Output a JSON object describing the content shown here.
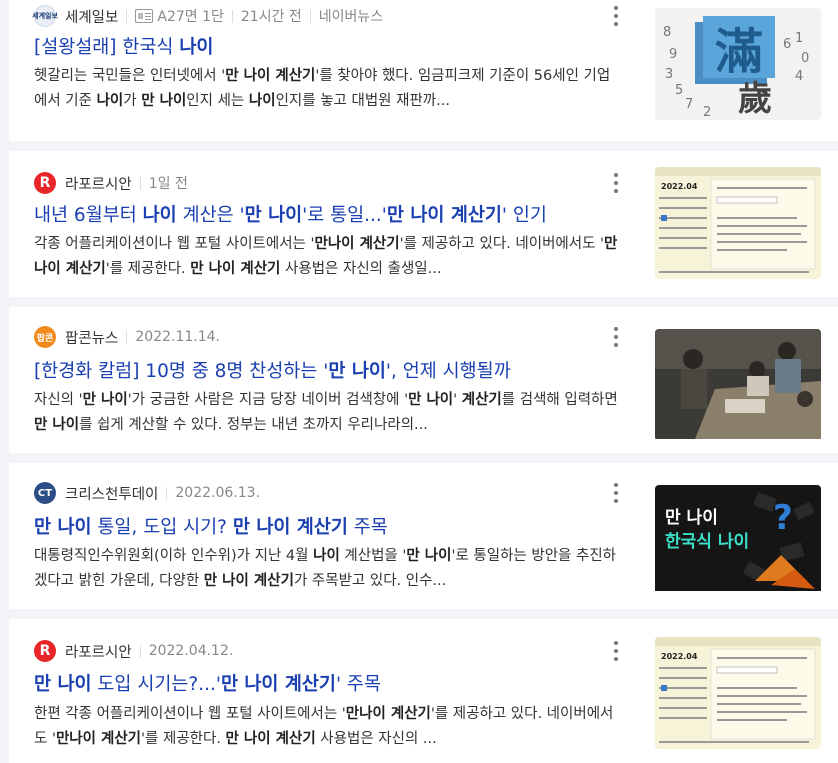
{
  "results": [
    {
      "source": "세계일보",
      "logo_text": "세계일보",
      "paper_label": "A27면 1단",
      "time": "21시간 전",
      "extra": "네이버뉴스",
      "title_parts": [
        "[설왕설래] 한국식 ",
        "나이"
      ],
      "desc_parts": [
        "헷갈리는 국민들은 인터넷에서 '",
        "만 나이 계산기",
        "'를 찾아야 했다. 임금피크제 기준이 56세인 기업에서 기준 ",
        "나이",
        "가 ",
        "만 나이",
        "인지 세는 ",
        "나이",
        "인지를 놓고 대법원 재판까..."
      ],
      "thumb_text": "滿 歲"
    },
    {
      "source": "라포르시안",
      "logo_text": "R",
      "time": "1일 전",
      "title_parts": [
        "내년 6월부터 ",
        "나이",
        " 계산은 '",
        "만 나이",
        "'로 통일...'",
        "만 나이 계산기",
        "' 인기"
      ],
      "desc_parts": [
        "각종 어플리케이션이나 웹 포털 사이트에서는 '",
        "만나이 계산기",
        "'를 제공하고 있다. 네이버에서도 '",
        "만나이 계산기",
        "'를 제공한다. ",
        "만 나이 계산기",
        " 사용법은 자신의 출생일..."
      ],
      "thumb_year": "2022.04"
    },
    {
      "source": "팝콘뉴스",
      "logo_text": "팝콘",
      "time": "2022.11.14.",
      "title_parts": [
        "[한경화 칼럼] 10명 중 8명 찬성하는 '",
        "만 나이",
        "', 언제 시행될까"
      ],
      "desc_parts": [
        "자신의 '",
        "만 나이",
        "'가 궁금한 사람은 지금 당장 네이버 검색창에 '",
        "만 나이",
        "' ",
        "계산기",
        "를 검색해 입력하면 ",
        "만 나이",
        "를 쉽게 계산할 수 있다. 정부는 내년 초까지 우리나라의..."
      ]
    },
    {
      "source": "크리스천투데이",
      "logo_text": "CT",
      "time": "2022.06.13.",
      "title_parts": [
        "",
        "만 나이",
        " 통일, 도입 시기? ",
        "만 나이 계산기",
        " 주목"
      ],
      "desc_parts": [
        "대통령직인수위원회(이하 인수위)가 지난 4월 ",
        "나이",
        " 계산법을 '",
        "만 나이",
        "'로 통일하는 방안을 추진하겠다고 밝힌 가운데, 다양한 ",
        "만 나이 계산기",
        "가 주목받고 있다. 인수..."
      ],
      "thumb_line1": "만 나이",
      "thumb_line2": "한국식 나이"
    },
    {
      "source": "라포르시안",
      "logo_text": "R",
      "time": "2022.04.12.",
      "title_parts": [
        "",
        "만 나이",
        " 도입 시기는?...'",
        "만 나이 계산기",
        "' 주목"
      ],
      "desc_parts": [
        "한편 각종 어플리케이션이나 웹 포털 사이트에서는 '",
        "만나이 계산기",
        "'를 제공하고 있다. 네이버에서도 '",
        "만나이 계산기",
        "'를 제공한다. ",
        "만 나이 계산기",
        " 사용법은 자신의 ..."
      ],
      "thumb_year": "2022.04"
    }
  ],
  "colors": {
    "title": "#1a3fb0",
    "background": "#f3f4f7"
  }
}
